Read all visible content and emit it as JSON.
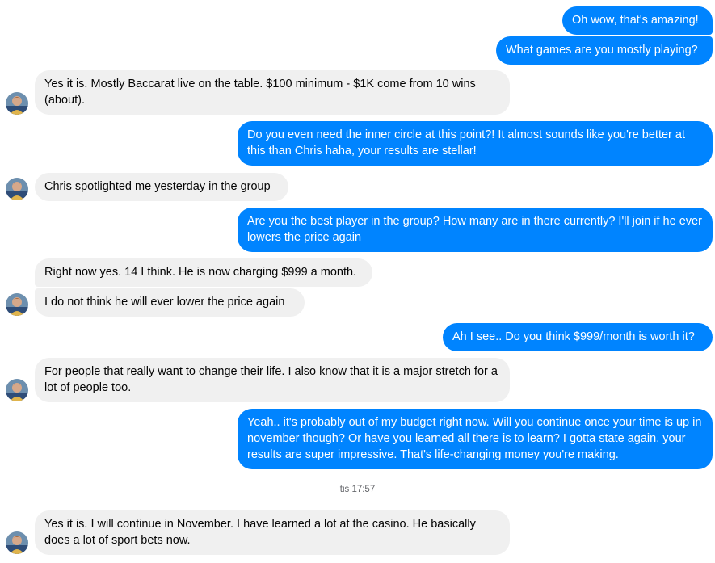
{
  "conversation": {
    "timestamp": "tis 17:57",
    "messages": [
      {
        "id": "m1",
        "from": "me",
        "text": "Oh wow, that's amazing!"
      },
      {
        "id": "m2",
        "from": "me",
        "text": "What games are you mostly playing?"
      },
      {
        "id": "m3",
        "from": "them",
        "text": "Yes it is. Mostly Baccarat live on the table. $100 minimum - $1K come from 10 wins (about)."
      },
      {
        "id": "m4",
        "from": "me",
        "text": "Do you even need the inner circle at this point?! It almost sounds like you're better at this than Chris haha, your results are stellar!"
      },
      {
        "id": "m5",
        "from": "them",
        "text": "Chris spotlighted me yesterday in the group"
      },
      {
        "id": "m6",
        "from": "me",
        "text": "Are you the best player in the group? How many are in there currently? I'll join if he ever lowers the price again"
      },
      {
        "id": "m7",
        "from": "them",
        "text": "Right now yes. 14 I think. He is now charging $999 a month."
      },
      {
        "id": "m8",
        "from": "them",
        "text": "I do not think he will ever lower the price again"
      },
      {
        "id": "m9",
        "from": "me",
        "text": "Ah I see.. Do you think $999/month is worth it?"
      },
      {
        "id": "m10",
        "from": "them",
        "text": "For people that really want to change their life. I also know that it is a major stretch for a lot of people too."
      },
      {
        "id": "m11",
        "from": "me",
        "text": "Yeah.. it's probably out of my budget right now. Will you continue once your time is up in november though? Or have you learned all there is to learn? I gotta state again, your results are super impressive. That's life-changing money you're making."
      },
      {
        "id": "m12",
        "from": "them",
        "text": "Yes it is. I will continue in November. I have learned a lot at the casino. He basically does a lot of sport bets now."
      }
    ]
  },
  "colors": {
    "outgoing_bubble": "#0084ff",
    "incoming_bubble": "#f0f0f0",
    "timestamp_text": "#65676b"
  },
  "icons": {
    "avatar": "contact-avatar-photo"
  }
}
